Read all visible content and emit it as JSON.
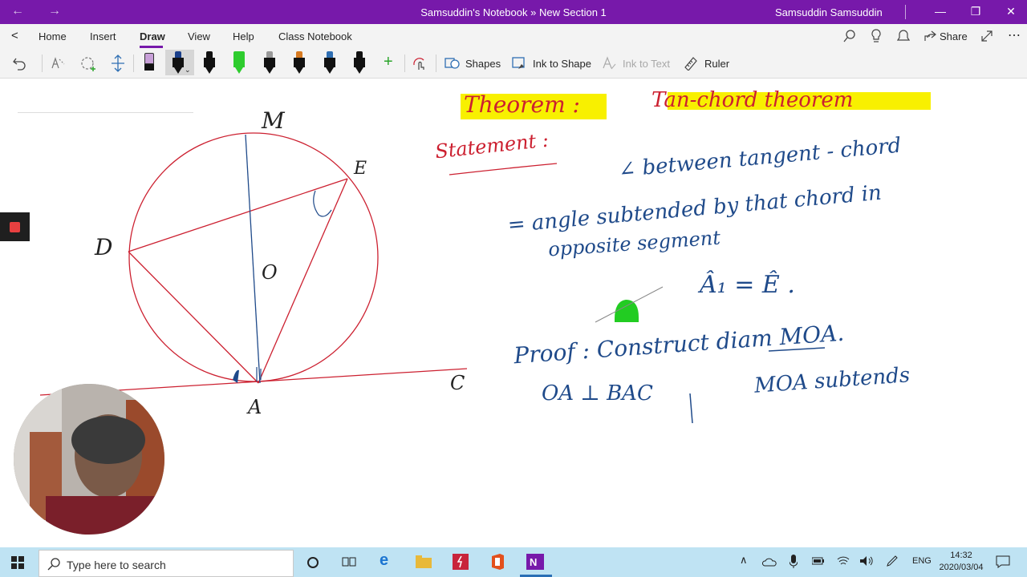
{
  "window": {
    "title": "Samsuddin's Notebook » New Section 1",
    "user": "Samsuddin Samsuddin",
    "back": "←",
    "forward": "→",
    "minimize": "—",
    "restore": "❐",
    "close": "✕"
  },
  "menu": {
    "back": "<",
    "items": [
      "Home",
      "Insert",
      "Draw",
      "View",
      "Help",
      "Class Notebook"
    ],
    "active": "Draw",
    "share": "Share"
  },
  "toolbar": {
    "shapes": "Shapes",
    "ink_to_shape": "Ink to Shape",
    "ink_to_text": "Ink to Text",
    "ruler": "Ruler",
    "pens": [
      {
        "tip": "#c8a0d8",
        "body": "#111111"
      },
      {
        "tip": "#1a3f8a",
        "body": "#111111"
      },
      {
        "tip": "#111111",
        "body": "#111111"
      },
      {
        "tip": "#2ecc2e",
        "body": "#2ecc2e"
      },
      {
        "tip": "#999999",
        "body": "#111111"
      },
      {
        "tip": "#d77a20",
        "body": "#111111"
      },
      {
        "tip": "#2f6fb3",
        "body": "#111111"
      },
      {
        "tip": "#111111",
        "body": "#111111"
      }
    ]
  },
  "notes": {
    "theorem": "Theorem :",
    "theorem_name": "Tan-chord theorem",
    "statement": "Statement :",
    "line1": "∠ between tangent - chord",
    "line2": "= angle subtended by that chord in",
    "line3": "opposite segment",
    "line4": "Â₁ = Ê .",
    "proof1": "Proof : Construct diam MOA.",
    "proof2": "OA ⊥ BAC",
    "proof3": "MOA subtends",
    "labels": {
      "M": "M",
      "E": "E",
      "D": "D",
      "O": "O",
      "A": "A",
      "C": "C"
    }
  },
  "colors": {
    "accent": "#7719aa",
    "red_ink": "#cc2030",
    "blue_ink": "#1f4a8a",
    "highlight": "#f8f000",
    "green_ink": "#22cc22"
  },
  "taskbar": {
    "search_placeholder": "Type here to search",
    "time": "14:32",
    "date": "2020/03/04",
    "lang": "ENG"
  }
}
